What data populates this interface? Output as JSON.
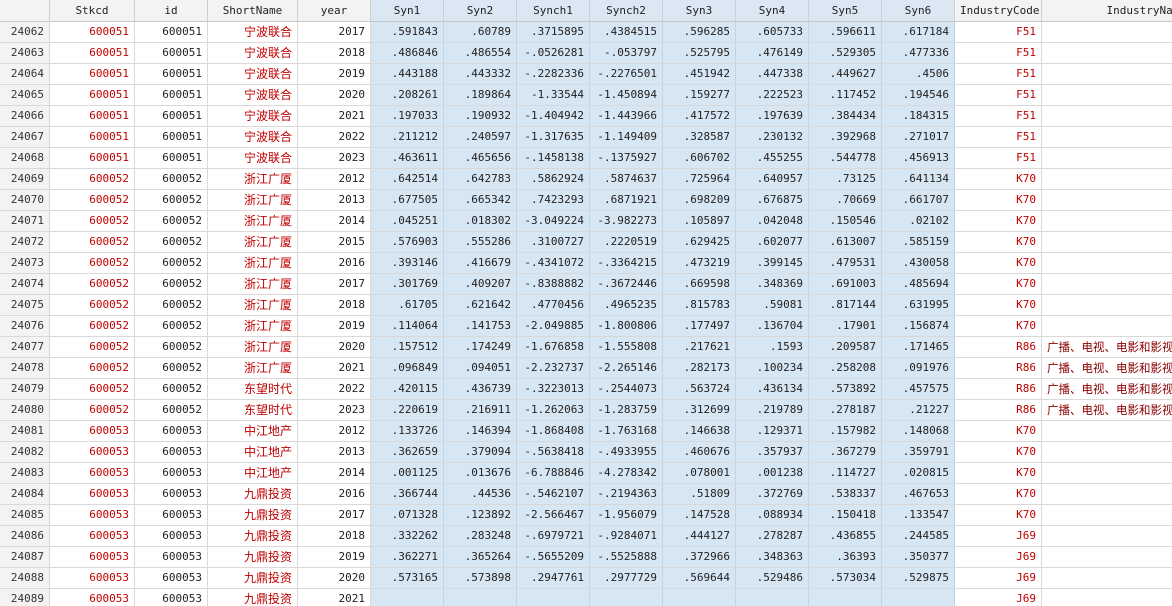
{
  "columns": [
    "Stkcd",
    "id",
    "ShortName",
    "year",
    "Syn1",
    "Syn2",
    "Synch1",
    "Synch2",
    "Syn3",
    "Syn4",
    "Syn5",
    "Syn6",
    "IndustryCode",
    "IndustryName"
  ],
  "rows": [
    {
      "rn": "24062",
      "stkcd": "600051",
      "id": "600051",
      "sn": "宁波联合",
      "year": "2017",
      "s": [
        ".591843",
        ".60789",
        ".3715895",
        ".4384515",
        ".596285",
        ".605733",
        ".596611",
        ".617184"
      ],
      "ic": "F51",
      "in": ""
    },
    {
      "rn": "24063",
      "stkcd": "600051",
      "id": "600051",
      "sn": "宁波联合",
      "year": "2018",
      "s": [
        ".486846",
        ".486554",
        "-.0526281",
        "-.053797",
        ".525795",
        ".476149",
        ".529305",
        ".477336"
      ],
      "ic": "F51",
      "in": ""
    },
    {
      "rn": "24064",
      "stkcd": "600051",
      "id": "600051",
      "sn": "宁波联合",
      "year": "2019",
      "s": [
        ".443188",
        ".443332",
        "-.2282336",
        "-.2276501",
        ".451942",
        ".447338",
        ".449627",
        ".4506"
      ],
      "ic": "F51",
      "in": ""
    },
    {
      "rn": "24065",
      "stkcd": "600051",
      "id": "600051",
      "sn": "宁波联合",
      "year": "2020",
      "s": [
        ".208261",
        ".189864",
        "-1.33544",
        "-1.450894",
        ".159277",
        ".222523",
        ".117452",
        ".194546"
      ],
      "ic": "F51",
      "in": ""
    },
    {
      "rn": "24066",
      "stkcd": "600051",
      "id": "600051",
      "sn": "宁波联合",
      "year": "2021",
      "s": [
        ".197033",
        ".190932",
        "-1.404942",
        "-1.443966",
        ".417572",
        ".197639",
        ".384434",
        ".184315"
      ],
      "ic": "F51",
      "in": ""
    },
    {
      "rn": "24067",
      "stkcd": "600051",
      "id": "600051",
      "sn": "宁波联合",
      "year": "2022",
      "s": [
        ".211212",
        ".240597",
        "-1.317635",
        "-1.149409",
        ".328587",
        ".230132",
        ".392968",
        ".271017"
      ],
      "ic": "F51",
      "in": ""
    },
    {
      "rn": "24068",
      "stkcd": "600051",
      "id": "600051",
      "sn": "宁波联合",
      "year": "2023",
      "s": [
        ".463611",
        ".465656",
        "-.1458138",
        "-.1375927",
        ".606702",
        ".455255",
        ".544778",
        ".456913"
      ],
      "ic": "F51",
      "in": ""
    },
    {
      "rn": "24069",
      "stkcd": "600052",
      "id": "600052",
      "sn": "浙江广厦",
      "year": "2012",
      "s": [
        ".642514",
        ".642783",
        ".5862924",
        ".5874637",
        ".725964",
        ".640957",
        ".73125",
        ".641134"
      ],
      "ic": "K70",
      "in": ""
    },
    {
      "rn": "24070",
      "stkcd": "600052",
      "id": "600052",
      "sn": "浙江广厦",
      "year": "2013",
      "s": [
        ".677505",
        ".665342",
        ".7423293",
        ".6871921",
        ".698209",
        ".676875",
        ".70669",
        ".661707"
      ],
      "ic": "K70",
      "in": ""
    },
    {
      "rn": "24071",
      "stkcd": "600052",
      "id": "600052",
      "sn": "浙江广厦",
      "year": "2014",
      "s": [
        ".045251",
        ".018302",
        "-3.049224",
        "-3.982273",
        ".105897",
        ".042048",
        ".150546",
        ".02102"
      ],
      "ic": "K70",
      "in": ""
    },
    {
      "rn": "24072",
      "stkcd": "600052",
      "id": "600052",
      "sn": "浙江广厦",
      "year": "2015",
      "s": [
        ".576903",
        ".555286",
        ".3100727",
        ".2220519",
        ".629425",
        ".602077",
        ".613007",
        ".585159"
      ],
      "ic": "K70",
      "in": ""
    },
    {
      "rn": "24073",
      "stkcd": "600052",
      "id": "600052",
      "sn": "浙江广厦",
      "year": "2016",
      "s": [
        ".393146",
        ".416679",
        "-.4341072",
        "-.3364215",
        ".473219",
        ".399145",
        ".479531",
        ".430058"
      ],
      "ic": "K70",
      "in": ""
    },
    {
      "rn": "24074",
      "stkcd": "600052",
      "id": "600052",
      "sn": "浙江广厦",
      "year": "2017",
      "s": [
        ".301769",
        ".409207",
        "-.8388882",
        "-.3672446",
        ".669598",
        ".348369",
        ".691003",
        ".485694"
      ],
      "ic": "K70",
      "in": ""
    },
    {
      "rn": "24075",
      "stkcd": "600052",
      "id": "600052",
      "sn": "浙江广厦",
      "year": "2018",
      "s": [
        ".61705",
        ".621642",
        ".4770456",
        ".4965235",
        ".815783",
        ".59081",
        ".817144",
        ".631995"
      ],
      "ic": "K70",
      "in": ""
    },
    {
      "rn": "24076",
      "stkcd": "600052",
      "id": "600052",
      "sn": "浙江广厦",
      "year": "2019",
      "s": [
        ".114064",
        ".141753",
        "-2.049885",
        "-1.800806",
        ".177497",
        ".136704",
        ".17901",
        ".156874"
      ],
      "ic": "K70",
      "in": ""
    },
    {
      "rn": "24077",
      "stkcd": "600052",
      "id": "600052",
      "sn": "浙江广厦",
      "year": "2020",
      "s": [
        ".157512",
        ".174249",
        "-1.676858",
        "-1.555808",
        ".217621",
        ".1593",
        ".209587",
        ".171465"
      ],
      "ic": "R86",
      "in": "广播、电视、电影和影视"
    },
    {
      "rn": "24078",
      "stkcd": "600052",
      "id": "600052",
      "sn": "浙江广厦",
      "year": "2021",
      "s": [
        ".096849",
        ".094051",
        "-2.232737",
        "-2.265146",
        ".282173",
        ".100234",
        ".258208",
        ".091976"
      ],
      "ic": "R86",
      "in": "广播、电视、电影和影视"
    },
    {
      "rn": "24079",
      "stkcd": "600052",
      "id": "600052",
      "sn": "东望时代",
      "year": "2022",
      "s": [
        ".420115",
        ".436739",
        "-.3223013",
        "-.2544073",
        ".563724",
        ".436134",
        ".573892",
        ".457575"
      ],
      "ic": "R86",
      "in": "广播、电视、电影和影视"
    },
    {
      "rn": "24080",
      "stkcd": "600052",
      "id": "600052",
      "sn": "东望时代",
      "year": "2023",
      "s": [
        ".220619",
        ".216911",
        "-1.262063",
        "-1.283759",
        ".312699",
        ".219789",
        ".278187",
        ".21227"
      ],
      "ic": "R86",
      "in": "广播、电视、电影和影视"
    },
    {
      "rn": "24081",
      "stkcd": "600053",
      "id": "600053",
      "sn": "中江地产",
      "year": "2012",
      "s": [
        ".133726",
        ".146394",
        "-1.868408",
        "-1.763168",
        ".146638",
        ".129371",
        ".157982",
        ".148068"
      ],
      "ic": "K70",
      "in": ""
    },
    {
      "rn": "24082",
      "stkcd": "600053",
      "id": "600053",
      "sn": "中江地产",
      "year": "2013",
      "s": [
        ".362659",
        ".379094",
        "-.5638418",
        "-.4933955",
        ".460676",
        ".357937",
        ".367279",
        ".359791"
      ],
      "ic": "K70",
      "in": ""
    },
    {
      "rn": "24083",
      "stkcd": "600053",
      "id": "600053",
      "sn": "中江地产",
      "year": "2014",
      "s": [
        ".001125",
        ".013676",
        "-6.788846",
        "-4.278342",
        ".078001",
        ".001238",
        ".114727",
        ".020815"
      ],
      "ic": "K70",
      "in": ""
    },
    {
      "rn": "24084",
      "stkcd": "600053",
      "id": "600053",
      "sn": "九鼎投资",
      "year": "2016",
      "s": [
        ".366744",
        ".44536",
        "-.5462107",
        "-.2194363",
        ".51809",
        ".372769",
        ".538337",
        ".467653"
      ],
      "ic": "K70",
      "in": ""
    },
    {
      "rn": "24085",
      "stkcd": "600053",
      "id": "600053",
      "sn": "九鼎投资",
      "year": "2017",
      "s": [
        ".071328",
        ".123892",
        "-2.566467",
        "-1.956079",
        ".147528",
        ".088934",
        ".150418",
        ".133547"
      ],
      "ic": "K70",
      "in": ""
    },
    {
      "rn": "24086",
      "stkcd": "600053",
      "id": "600053",
      "sn": "九鼎投资",
      "year": "2018",
      "s": [
        ".332262",
        ".283248",
        "-.6979721",
        "-.9284071",
        ".444127",
        ".278287",
        ".436855",
        ".244585"
      ],
      "ic": "J69",
      "in": ""
    },
    {
      "rn": "24087",
      "stkcd": "600053",
      "id": "600053",
      "sn": "九鼎投资",
      "year": "2019",
      "s": [
        ".362271",
        ".365264",
        "-.5655209",
        "-.5525888",
        ".372966",
        ".348363",
        ".36393",
        ".350377"
      ],
      "ic": "J69",
      "in": ""
    },
    {
      "rn": "24088",
      "stkcd": "600053",
      "id": "600053",
      "sn": "九鼎投资",
      "year": "2020",
      "s": [
        ".573165",
        ".573898",
        ".2947761",
        ".2977729",
        ".569644",
        ".529486",
        ".573034",
        ".529875"
      ],
      "ic": "J69",
      "in": ""
    },
    {
      "rn": "24089",
      "stkcd": "600053",
      "id": "600053",
      "sn": "九鼎投资",
      "year": "2021",
      "s": [
        "",
        "",
        "",
        "",
        "",
        "",
        "",
        ""
      ],
      "ic": "J69",
      "in": ""
    }
  ]
}
